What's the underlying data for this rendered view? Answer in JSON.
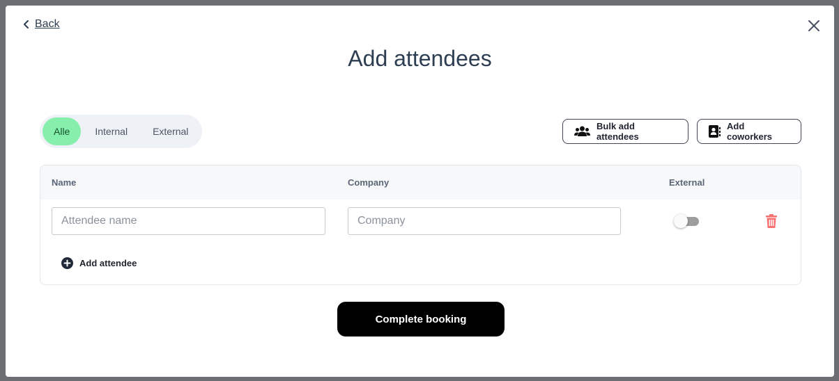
{
  "header": {
    "back_label": "Back",
    "title": "Add attendees"
  },
  "filter": {
    "tabs": [
      {
        "label": "Alle",
        "active": true
      },
      {
        "label": "Internal",
        "active": false
      },
      {
        "label": "External",
        "active": false
      }
    ]
  },
  "actions": {
    "bulk_label": "Bulk add attendees",
    "coworkers_label": "Add coworkers"
  },
  "table": {
    "columns": [
      "Name",
      "Company",
      "External"
    ],
    "row": {
      "name_value": "",
      "name_placeholder": "Attendee name",
      "company_value": "",
      "company_placeholder": "Company",
      "external": false
    },
    "add_label": "Add attendee"
  },
  "footer": {
    "complete_label": "Complete booking"
  },
  "colors": {
    "accent": "#86efac",
    "delete": "#f87171",
    "primary_button": "#000000"
  }
}
